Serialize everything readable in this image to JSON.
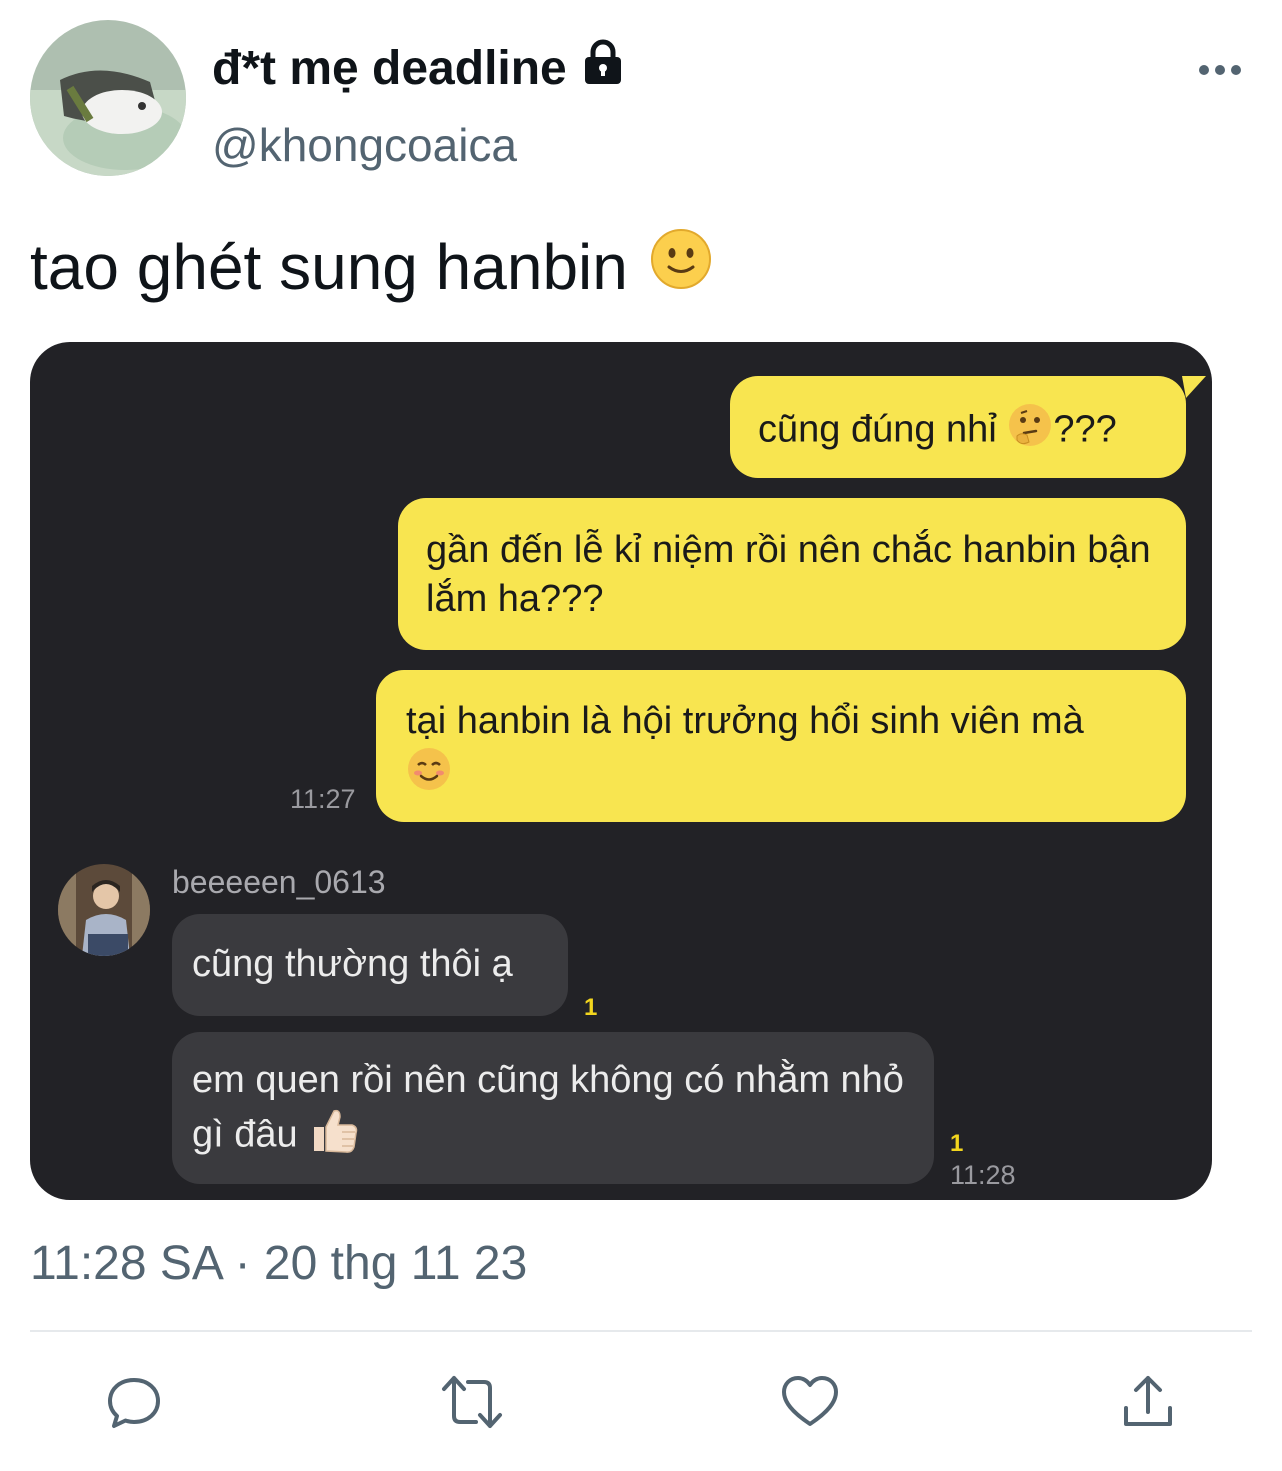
{
  "header": {
    "display_name": "đ*t mẹ deadline",
    "handle": "@khongcoaica",
    "lock_icon": "lock-icon",
    "more_icon": "more-icon"
  },
  "tweet": {
    "text": "tao ghét sung hanbin",
    "emoji": "slightly-smiling-face",
    "timestamp": "11:28 SA · 20 thg 11 23"
  },
  "chat": {
    "outgoing": [
      {
        "text": "cũng đúng nhỉ",
        "suffix": "???"
      },
      {
        "text": "gần đến lễ kỉ niệm rồi nên chắc hanbin bận lắm ha???"
      },
      {
        "text": "tại hanbin là hội trưởng hổi sinh viên mà"
      }
    ],
    "outgoing_time": "11:27",
    "friend_name": "beeeeen_0613",
    "incoming": [
      {
        "text": "cũng thường thôi ạ",
        "unread": "1"
      },
      {
        "text": "em quen rồi nên cũng không có nhằm nhỏ gì đâu",
        "unread": "1"
      }
    ],
    "incoming_time": "11:28"
  },
  "actions": [
    "reply-icon",
    "retweet-icon",
    "like-icon",
    "share-icon"
  ],
  "colors": {
    "text": "#0f1419",
    "secondary": "#536471",
    "chat_bg": "#222226",
    "bubble_yellow": "#f8e550",
    "bubble_gray": "#3a3a3e"
  }
}
